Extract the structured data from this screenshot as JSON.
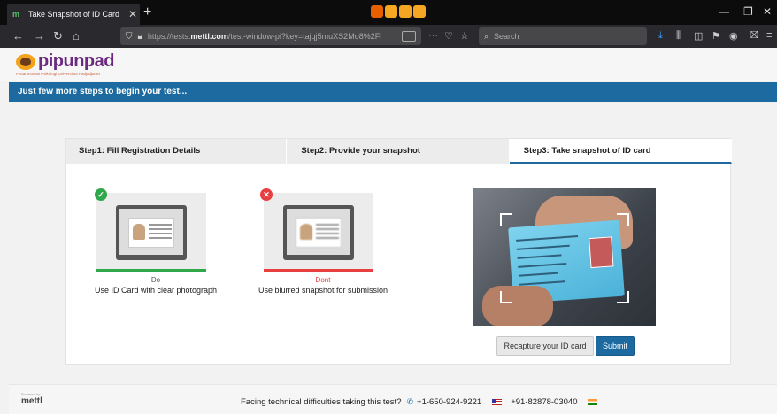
{
  "browser": {
    "tab_title": "Take Snapshot of ID Card",
    "url_prefix": "https://tests.",
    "url_domain": "mettl.com",
    "url_rest": "/test-window-pi?key=tajqj5muXS2Mo8%2Fl",
    "search_placeholder": "Search"
  },
  "header": {
    "logo_text": "pipunpad",
    "logo_subtitle": "Pusat Inovasi Psikologi Universitas Padjadjaran"
  },
  "banner": {
    "text": "Just few more steps to begin your test..."
  },
  "steps": [
    {
      "label": "Step1: Fill Registration Details"
    },
    {
      "label": "Step2: Provide your snapshot"
    },
    {
      "label": "Step3: Take snapshot of ID card"
    }
  ],
  "examples": {
    "do": {
      "label": "Do",
      "description": "Use ID Card with clear photograph",
      "color": "#2ea84a"
    },
    "dont": {
      "label": "Dont",
      "description": "Use blurred snapshot for submission",
      "color": "#e84040"
    }
  },
  "buttons": {
    "recapture": "Recapture your ID card",
    "submit": "Submit"
  },
  "footer": {
    "powered_by": "Powered by",
    "brand": "mettl",
    "help_text": "Facing technical difficulties taking this test?",
    "phone_us": "+1-650-924-9221",
    "phone_in": "+91-82878-03040"
  },
  "colors": {
    "accent": "#1c6aa0"
  }
}
